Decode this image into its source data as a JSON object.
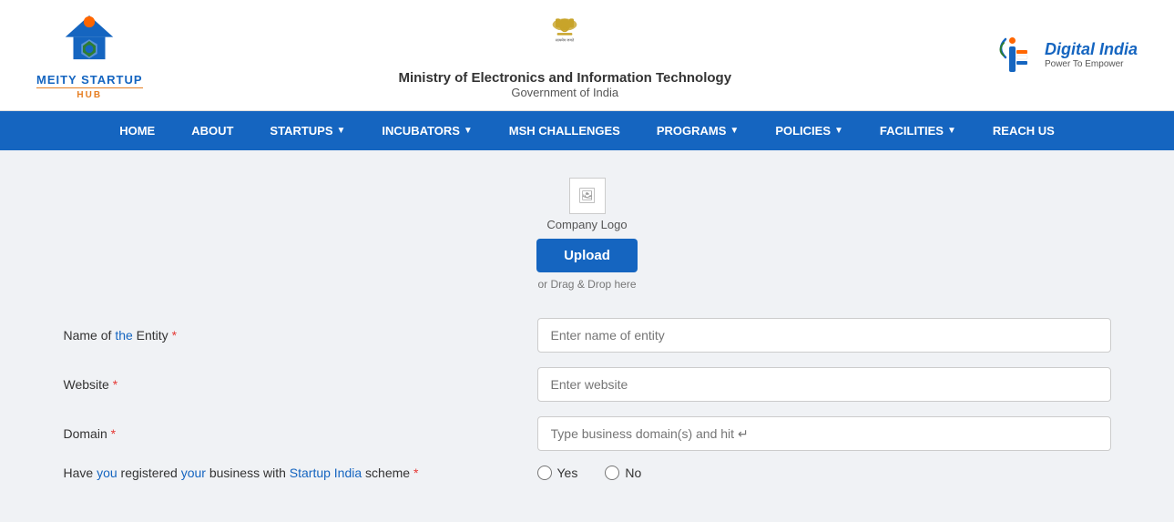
{
  "header": {
    "meity": {
      "line1": "MEITY STARTUP",
      "line2": "HUB"
    },
    "center": {
      "ministry_name": "Ministry of Electronics and Information Technology",
      "gov_name": "Government of India"
    },
    "digital_india": {
      "label": "Digital India",
      "sublabel": "Power To Empower"
    }
  },
  "navbar": {
    "items": [
      {
        "label": "HOME",
        "has_dropdown": false
      },
      {
        "label": "ABOUT",
        "has_dropdown": false
      },
      {
        "label": "STARTUPS",
        "has_dropdown": true
      },
      {
        "label": "INCUBATORS",
        "has_dropdown": true
      },
      {
        "label": "MSH CHALLENGES",
        "has_dropdown": false
      },
      {
        "label": "PROGRAMS",
        "has_dropdown": true
      },
      {
        "label": "POLICIES",
        "has_dropdown": true
      },
      {
        "label": "FACILITIES",
        "has_dropdown": true
      },
      {
        "label": "REACH US",
        "has_dropdown": false
      }
    ]
  },
  "upload": {
    "logo_label": "Company Logo",
    "button_label": "Upload",
    "drag_drop_text": "or Drag & Drop here"
  },
  "form": {
    "fields": [
      {
        "label": "Name of ",
        "label_highlight": "the",
        "label_rest": " Entity ",
        "required": true,
        "type": "text",
        "placeholder": "Enter name of entity"
      },
      {
        "label": "Website ",
        "label_highlight": "",
        "label_rest": "",
        "required": true,
        "type": "text",
        "placeholder": "Enter website"
      },
      {
        "label": "Domain ",
        "label_highlight": "",
        "label_rest": "",
        "required": true,
        "type": "text",
        "placeholder": "Type business domain(s) and hit ↵"
      },
      {
        "label": "Have ",
        "label_highlight": "you",
        "label_middle": " registered ",
        "label_highlight2": "your",
        "label_middle2": " business with ",
        "label_highlight3": "Startup India",
        "label_rest": " scheme ",
        "required": true,
        "type": "radio",
        "options": [
          "Yes",
          "No"
        ]
      }
    ]
  }
}
